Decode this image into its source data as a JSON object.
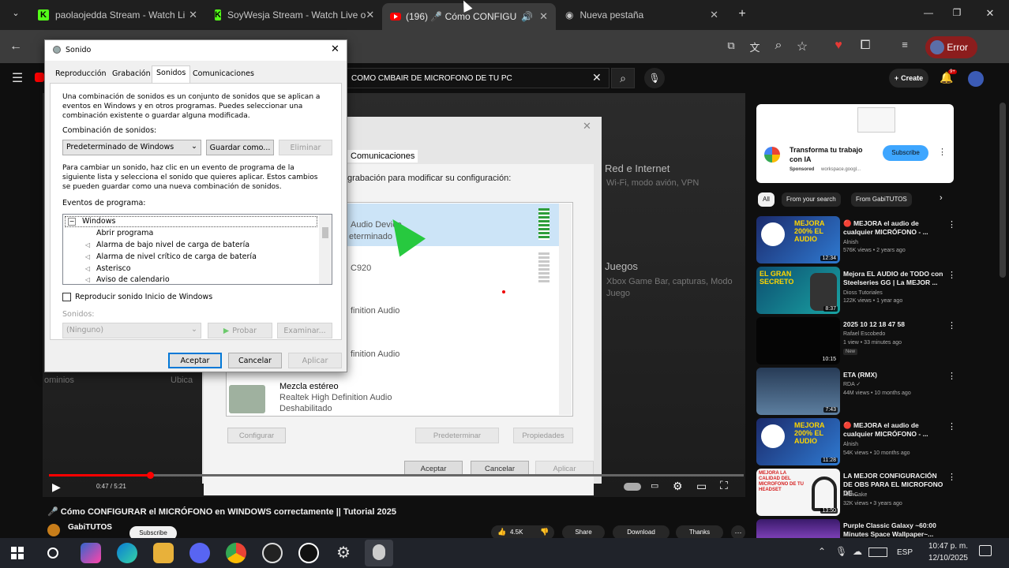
{
  "browser": {
    "tabs": [
      {
        "title": "paolaojedda Stream - Watch Li",
        "icon": "kick-icon"
      },
      {
        "title": "SoyWesja Stream - Watch Live o",
        "icon": "kick-icon"
      },
      {
        "title": "(196) 🎤 Cómo CONFIGURA",
        "icon": "youtube-icon",
        "active": true
      },
      {
        "title": "Nueva pestaña",
        "icon": "globe-icon"
      }
    ],
    "profile_button": "Error"
  },
  "youtube": {
    "search_query": "COMO CMBAIR DE MICROFONO DE TU PC",
    "create_label": "Create",
    "notifications": "9+",
    "video_title": "🎤 Cómo CONFIGURAR el MICRÓFONO en WINDOWS correctamente || Tutorial 2025",
    "channel": "GabiTUTOS",
    "subscribe": "Subscribe",
    "time": "0:47 / 5:21",
    "likes": "4.5K",
    "share": "Share",
    "download": "Download",
    "thanks": "Thanks",
    "ad": {
      "title": "Transforma tu trabajo con IA",
      "sponsor": "Sponsored",
      "domain": "workspace.googl...",
      "cta": "Subscribe"
    },
    "chips": [
      "All",
      "From your search",
      "From GabiTUTOS"
    ],
    "recommendations": [
      {
        "title": "🔴 MEJORA el audio de cualquier MICRÓFONO - ...",
        "channel": "Alnish",
        "meta": "576K views • 2 years ago",
        "duration": "12:34",
        "thumb_text": "MEJORA 200% EL AUDIO"
      },
      {
        "title": "Mejora EL AUDIO de TODO con Steelseries GG | La MEJOR ...",
        "channel": "Dioss Tutoriales",
        "meta": "122K views • 1 year ago",
        "duration": "8:37",
        "thumb_text": "EL GRAN SECRETO"
      },
      {
        "title": "2025 10 12 18 47 58",
        "channel": "Rafael Escobedo",
        "meta": "1 view • 33 minutes ago",
        "badge": "New",
        "duration": "10:15",
        "thumb_text": ""
      },
      {
        "title": "ETA (RMX)",
        "channel": "RDA ✓",
        "meta": "44M views • 10 months ago",
        "duration": "7:43",
        "thumb_text": ""
      },
      {
        "title": "🔴 MEJORA el audio de cualquier MICRÓFONO - ...",
        "channel": "Alnish",
        "meta": "54K views • 10 months ago",
        "duration": "11:28",
        "thumb_text": "MEJORA 200% EL AUDIO"
      },
      {
        "title": "LA MEJOR CONFIGURACIÓN DE OBS PARA EL MICROFONO DE...",
        "channel": "RichCake",
        "meta": "32K views • 3 years ago",
        "duration": "13:50",
        "thumb_text": "MEJORA LA CALIDAD DEL MICROFONO DE TU HEADSET"
      },
      {
        "title": "Purple Classic Galaxy ~60:00 Minutes Space Wallpaper~...",
        "channel": "",
        "meta": "",
        "duration": "",
        "thumb_text": ""
      }
    ]
  },
  "bg_dialog": {
    "tab": "Comunicaciones",
    "instructions": "grabación para modificar su configuración:",
    "devices": [
      {
        "name": "Audio Device",
        "sub": "eterminado"
      },
      {
        "name": "C920",
        "sub": ""
      },
      {
        "name": "finition Audio",
        "sub": ""
      },
      {
        "name": "finition Audio",
        "sub": ""
      },
      {
        "name": "Mezcla estéreo",
        "sub": "Realtek High Definition Audio",
        "status": "Deshabilitado"
      }
    ],
    "configure": "Configurar",
    "default": "Predeterminar",
    "properties": "Propiedades",
    "ok": "Aceptar",
    "cancel": "Cancelar",
    "apply": "Aplicar",
    "settings_right": [
      {
        "title": "Red e Internet",
        "sub": "Wi-Fi, modo avión, VPN"
      },
      {
        "title": "Juegos",
        "sub": "Xbox Game Bar, capturas, Modo Juego"
      }
    ],
    "partial_left": [
      "ominios",
      "Ubica"
    ]
  },
  "sound_dialog": {
    "title": "Sonido",
    "tabs": [
      "Reproducción",
      "Grabación",
      "Sonidos",
      "Comunicaciones"
    ],
    "intro": "Una combinación de sonidos es un conjunto de sonidos que se aplican a eventos en Windows y en otros programas. Puedes seleccionar una combinación existente o guardar alguna modificada.",
    "scheme_label": "Combinación de sonidos:",
    "scheme_value": "Predeterminado de Windows",
    "save_as": "Guardar como...",
    "delete": "Eliminar",
    "change_text": "Para cambiar un sonido, haz clic en un evento de programa de la siguiente lista y selecciona el sonido que quieres aplicar. Estos cambios se pueden guardar como una nueva combinación de sonidos.",
    "events_label": "Eventos de programa:",
    "events": [
      "Windows",
      "Abrir programa",
      "Alarma de bajo nivel de carga de batería",
      "Alarma de nivel crítico de carga de batería",
      "Asterisco",
      "Aviso de calendario"
    ],
    "startup_checkbox": "Reproducir sonido Inicio de Windows",
    "sounds_label": "Sonidos:",
    "sounds_value": "(Ninguno)",
    "test": "Probar",
    "browse": "Examinar...",
    "ok": "Aceptar",
    "cancel": "Cancelar",
    "apply": "Aplicar"
  },
  "taskbar": {
    "lang": "ESP",
    "time": "10:47 p. m.",
    "date": "12/10/2025"
  }
}
